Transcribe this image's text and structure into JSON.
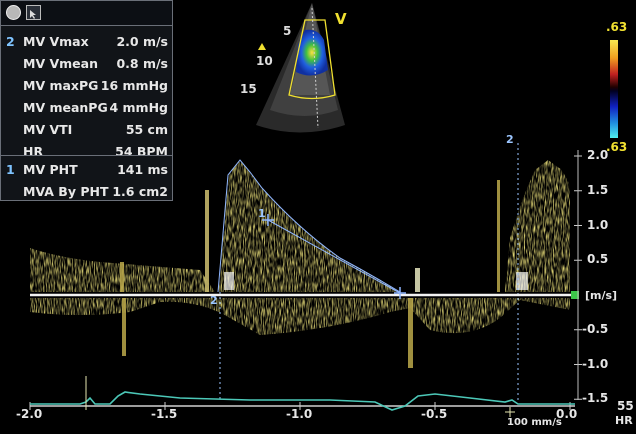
{
  "view": {
    "label": "V"
  },
  "depth_labels": [
    "5",
    "10",
    "15"
  ],
  "colorbar": {
    "top_label": ".63",
    "bottom_label": ".63"
  },
  "measurements": [
    {
      "index": "2",
      "label": "MV Vmax",
      "value": "2.0 m/s"
    },
    {
      "index": "",
      "label": "MV Vmean",
      "value": "0.8 m/s"
    },
    {
      "index": "",
      "label": "MV maxPG",
      "value": "16 mmHg"
    },
    {
      "index": "",
      "label": "MV meanPG",
      "value": "4 mmHg"
    },
    {
      "index": "",
      "label": "MV VTI",
      "value": "55 cm"
    },
    {
      "index": "",
      "label": "HR",
      "value": "54 BPM"
    },
    {
      "index": "1",
      "label": "MV PHT",
      "value": "141 ms"
    },
    {
      "index": "",
      "label": "MVA By PHT",
      "value": "1.6 cm2"
    }
  ],
  "y_axis": {
    "unit": "[m/s]",
    "ticks": [
      "2.0",
      "1.5",
      "1.0",
      "0.5",
      "-0.5",
      "-1.0",
      "-1.5"
    ],
    "tick_values": [
      2.0,
      1.5,
      1.0,
      0.5,
      -0.5,
      -1.0,
      -1.5
    ]
  },
  "x_axis": {
    "ticks": [
      "-2.0",
      "-1.5",
      "-1.0",
      "-0.5",
      "0.0"
    ],
    "tick_values": [
      -2.0,
      -1.5,
      -1.0,
      -0.5,
      0.0
    ]
  },
  "cursor_labels": {
    "vmax_cursor": "2",
    "pht_start": "1",
    "baseline_start": "2"
  },
  "sweep_speed": "100 mm/s",
  "hr": {
    "value": "55",
    "label": "HR"
  },
  "colors": {
    "doppler": "#d8c040",
    "baseline": "#f2f2f2",
    "ecg": "#4cc8b8",
    "trace": "#8fb6ff",
    "accent": "#f0e030"
  }
}
